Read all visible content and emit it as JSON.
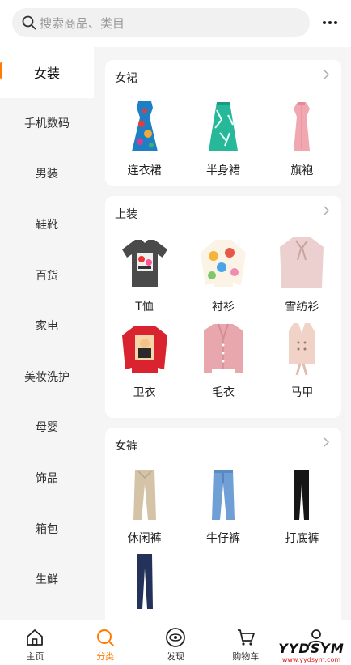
{
  "search": {
    "placeholder": "搜索商品、类目"
  },
  "sidebar": {
    "items": [
      {
        "label": "女装",
        "active": true
      },
      {
        "label": "手机数码"
      },
      {
        "label": "男装"
      },
      {
        "label": "鞋靴"
      },
      {
        "label": "百货"
      },
      {
        "label": "家电"
      },
      {
        "label": "美妆洗护"
      },
      {
        "label": "母婴"
      },
      {
        "label": "饰品"
      },
      {
        "label": "箱包"
      },
      {
        "label": "生鲜"
      }
    ]
  },
  "sections": [
    {
      "title": "女裙",
      "items": [
        "连衣裙",
        "半身裙",
        "旗袍"
      ]
    },
    {
      "title": "上装",
      "items": [
        "T恤",
        "衬衫",
        "雪纺衫",
        "卫衣",
        "毛衣",
        "马甲"
      ]
    },
    {
      "title": "女裤",
      "items": [
        "休闲裤",
        "牛仔裤",
        "打底裤",
        ""
      ]
    }
  ],
  "tabbar": {
    "items": [
      {
        "label": "主页",
        "icon": "home-icon"
      },
      {
        "label": "分类",
        "icon": "category-search-icon",
        "active": true
      },
      {
        "label": "发现",
        "icon": "eye-icon"
      },
      {
        "label": "购物车",
        "icon": "cart-icon"
      },
      {
        "label": "",
        "icon": "user-icon"
      }
    ]
  },
  "watermark": {
    "main": "YYDSYM",
    "sub": "www.yydsym.com"
  },
  "colors": {
    "accent": "#ff7a00",
    "background": "#f5f5f5"
  }
}
